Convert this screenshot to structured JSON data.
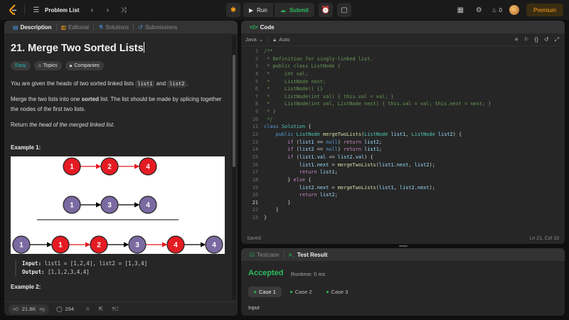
{
  "topbar": {
    "problem_list": "Problem List",
    "run": "Run",
    "submit": "Submit",
    "streak": "0",
    "premium": "Premium"
  },
  "left": {
    "tabs": [
      "Description",
      "Editorial",
      "Solutions",
      "Submissions"
    ],
    "title": "21. Merge Two Sorted Lists",
    "chips": {
      "difficulty": "Easy",
      "topics": "Topics",
      "companies": "Companies"
    },
    "p1": {
      "a": "You are given the heads of two sorted linked lists ",
      "c1": "list1",
      "b": " and ",
      "c2": "list2",
      "d": "."
    },
    "p2": {
      "a": "Merge the two lists into one ",
      "strong": "sorted",
      "b": " list. The list should be made by splicing together the nodes of the first two lists."
    },
    "p3": {
      "a": "Return ",
      "em": "the head of the merged linked list",
      "b": "."
    },
    "example1_title": "Example 1:",
    "diagram": {
      "list1": [
        "1",
        "2",
        "4"
      ],
      "list2": [
        "1",
        "3",
        "4"
      ],
      "merged": [
        "1",
        "1",
        "2",
        "3",
        "4",
        "4"
      ],
      "colors": {
        "red": "#e51b23",
        "purple": "#7b6aa1"
      }
    },
    "example1": {
      "input_label": "Input:",
      "input": "list1 = [1,2,4], list2 = [1,3,4]",
      "output_label": "Output:",
      "output": "[1,1,2,3,4,4]"
    },
    "example2_title": "Example 2:",
    "footer": {
      "likes": "21.8K",
      "comments": "294"
    }
  },
  "code": {
    "tab": "Code",
    "language": "Java",
    "mode": "Auto",
    "lines": [
      "/**",
      " * Definition for singly-linked list.",
      " * public class ListNode {",
      " *     int val;",
      " *     ListNode next;",
      " *     ListNode() {}",
      " *     ListNode(int val) { this.val = val; }",
      " *     ListNode(int val, ListNode next) { this.val = val; this.next = next; }",
      " * }",
      " */",
      "class Solution {",
      "    public ListNode mergeTwoLists(ListNode list1, ListNode list2) {",
      "        if (list1 == null) return list2;",
      "        if (list2 == null) return list1;",
      "        if (list1.val <= list2.val) {",
      "            list1.next = mergeTwoLists(list1.next, list2);",
      "            return list1;",
      "        } else {",
      "            list2.next = mergeTwoLists(list1, list2.next);",
      "            return list2;",
      "        }",
      "    }",
      "}"
    ],
    "status": "Saved",
    "position": "Ln 21, Col 10"
  },
  "test": {
    "tabs": [
      "Testcase",
      "Test Result"
    ],
    "result": "Accepted",
    "runtime": "Runtime: 0 ms",
    "cases": [
      "Case 1",
      "Case 2",
      "Case 3"
    ],
    "input_label": "Input"
  },
  "colors": {
    "accent": "#ffa116",
    "green": "#2cbb5d",
    "easy": "#1cbaba"
  }
}
